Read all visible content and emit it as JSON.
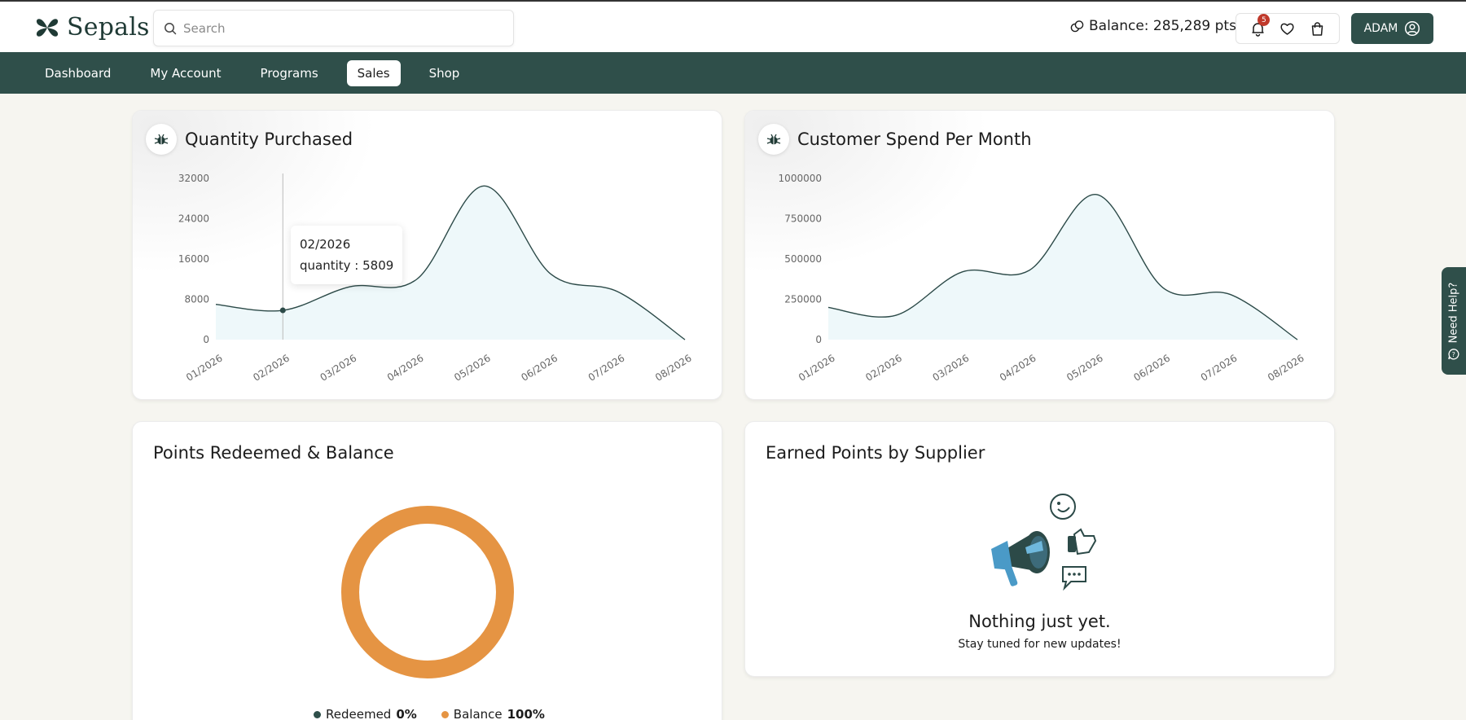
{
  "brand": {
    "name": "Sepals"
  },
  "search": {
    "placeholder": "Search"
  },
  "header": {
    "balance_label": "Balance: 285,289 pts",
    "notifications_count": "5",
    "user_label": "ADAM"
  },
  "nav": {
    "items": [
      "Dashboard",
      "My Account",
      "Programs",
      "Sales",
      "Shop"
    ],
    "active": "Sales"
  },
  "colors": {
    "primary": "#2f4f4a",
    "area_fill": "#eef8fa",
    "line": "#2c4a48",
    "donut_balance": "#e59443",
    "badge": "#c0392b"
  },
  "cards": {
    "quantity": {
      "title": "Quantity Purchased",
      "tooltip": {
        "date": "02/2026",
        "label": "quantity : 5809"
      }
    },
    "spend": {
      "title": "Customer Spend Per Month"
    },
    "points": {
      "title": "Points Redeemed & Balance",
      "legend": [
        {
          "label": "Redeemed",
          "value": "0%"
        },
        {
          "label": "Balance",
          "value": "100%"
        }
      ]
    },
    "earned": {
      "title": "Earned Points by Supplier",
      "empty_title": "Nothing just yet.",
      "empty_sub": "Stay tuned for new updates!"
    }
  },
  "help": {
    "label": "Need Help?"
  },
  "chart_data": [
    {
      "type": "area",
      "title": "Quantity Purchased",
      "categories": [
        "01/2026",
        "02/2026",
        "03/2026",
        "04/2026",
        "05/2026",
        "06/2026",
        "07/2026",
        "08/2026"
      ],
      "values": [
        7000,
        5809,
        10500,
        12000,
        30500,
        13000,
        9500,
        0
      ],
      "yticks": [
        0,
        8000,
        16000,
        24000,
        32000
      ],
      "ylim": [
        0,
        32000
      ],
      "highlight_index": 1
    },
    {
      "type": "area",
      "title": "Customer Spend Per Month",
      "categories": [
        "01/2026",
        "02/2026",
        "03/2026",
        "04/2026",
        "05/2026",
        "06/2026",
        "07/2026",
        "08/2026"
      ],
      "values": [
        200000,
        150000,
        420000,
        430000,
        900000,
        320000,
        280000,
        0
      ],
      "yticks": [
        0,
        250000,
        500000,
        750000,
        1000000
      ],
      "ylim": [
        0,
        1000000
      ]
    },
    {
      "type": "pie",
      "title": "Points Redeemed & Balance",
      "categories": [
        "Redeemed",
        "Balance"
      ],
      "values": [
        0,
        100
      ]
    }
  ]
}
